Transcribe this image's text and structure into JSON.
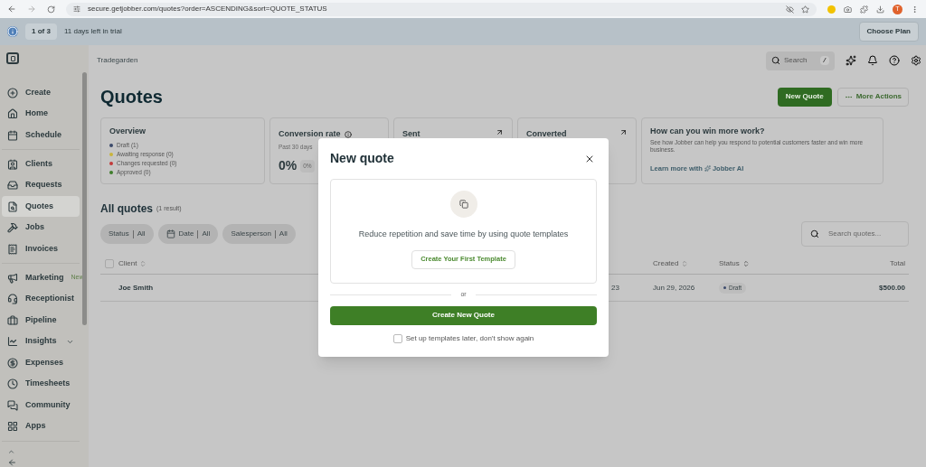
{
  "browser": {
    "url": "secure.getjobber.com/quotes?order=ASCENDING&sort=QUOTE_STATUS",
    "profile": "T"
  },
  "banner": {
    "step": "1 of 3",
    "text": "11 days left in trial",
    "button": "Choose Plan"
  },
  "topbar": {
    "account": "Tradegarden",
    "search": {
      "placeholder": "Search",
      "shortcut": "/"
    }
  },
  "sidebar": {
    "groups": [
      [
        {
          "label": "Create",
          "selected": false
        },
        {
          "label": "Home",
          "selected": false
        },
        {
          "label": "Schedule",
          "selected": false
        }
      ],
      [
        {
          "label": "Clients",
          "selected": false
        },
        {
          "label": "Requests",
          "selected": false
        },
        {
          "label": "Quotes",
          "selected": true
        },
        {
          "label": "Jobs",
          "selected": false
        },
        {
          "label": "Invoices",
          "selected": false
        }
      ],
      [
        {
          "label": "Marketing",
          "selected": false,
          "badge": "New"
        },
        {
          "label": "Receptionist",
          "selected": false
        },
        {
          "label": "Pipeline",
          "selected": false
        },
        {
          "label": "Insights",
          "selected": false,
          "expandable": true
        },
        {
          "label": "Expenses",
          "selected": false
        },
        {
          "label": "Timesheets",
          "selected": false
        },
        {
          "label": "Community",
          "selected": false
        },
        {
          "label": "Apps",
          "selected": false
        }
      ]
    ]
  },
  "page": {
    "title": "Quotes",
    "actions": [
      {
        "label": "New Quote",
        "kind": "primary"
      },
      {
        "label": "More Actions",
        "kind": "secondary"
      }
    ]
  },
  "overview": {
    "title": "Overview",
    "legend": [
      {
        "label": "Draft (1)",
        "color": "#3b4a6b"
      },
      {
        "label": "Awaiting response (0)",
        "color": "#c9b43c"
      },
      {
        "label": "Changes requested (0)",
        "color": "#c23a3a"
      },
      {
        "label": "Approved (0)",
        "color": "#3f7e2c"
      }
    ]
  },
  "conversion": {
    "title": "Conversion rate",
    "subtitle": "Past 30 days",
    "value": "0%",
    "chip": "0%"
  },
  "stat_cards": [
    {
      "title": "Sent"
    },
    {
      "title": "Converted"
    }
  ],
  "promo": {
    "title": "How can you win more work?",
    "text": "See how Jobber can help you respond to potential customers faster and win more business.",
    "link": "Learn more with",
    "link_brand": "Jobber AI"
  },
  "all_quotes": {
    "title": "All quotes",
    "count": "(1 result)",
    "filters": [
      {
        "label": "Status",
        "value": "All",
        "icon": false
      },
      {
        "label": "Date",
        "value": "All",
        "icon": true
      },
      {
        "label": "Salesperson",
        "value": "All",
        "icon": false
      }
    ],
    "search": {
      "placeholder": "Search quotes..."
    }
  },
  "table": {
    "select_all_checked": false,
    "columns": [
      "Client",
      "Created",
      "Status",
      "Total"
    ],
    "rows": [
      {
        "client": "Joe Smith",
        "column_2": "23",
        "created": "Jun 29, 2026",
        "status": "Draft",
        "total": "$500.00"
      }
    ]
  },
  "modal": {
    "title": "New quote",
    "description": "Reduce repetition and save time by using quote templates",
    "template_button": "Create Your First Template",
    "separator": "or",
    "create_button": "Create New Quote",
    "checkbox": {
      "label": "Set up templates later, don't show again",
      "checked": false
    }
  }
}
